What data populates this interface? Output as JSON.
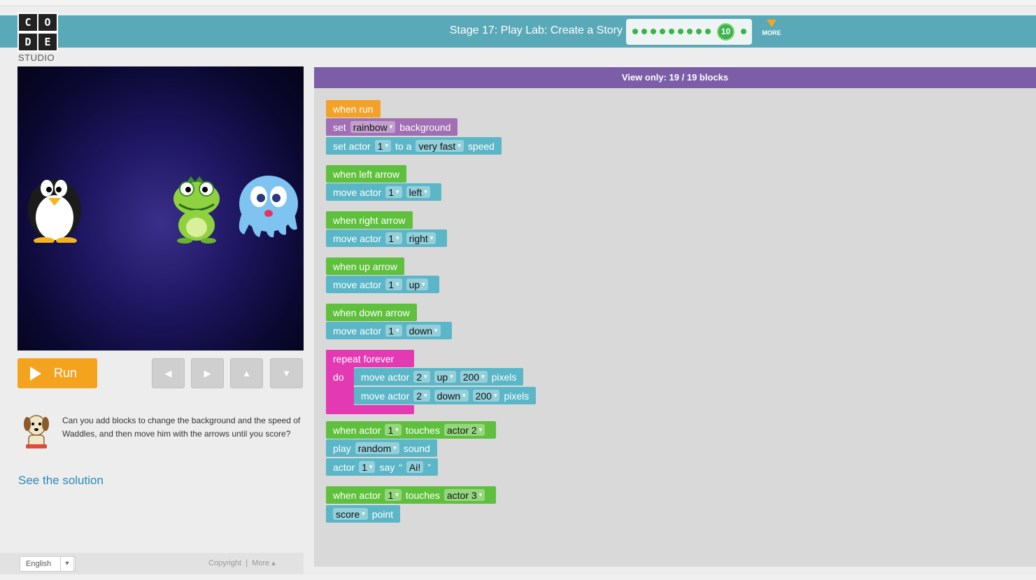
{
  "logo": {
    "letters": [
      "C",
      "O",
      "D",
      "E"
    ],
    "studio": "STUDIO"
  },
  "header": {
    "stage_title": "Stage 17: Play Lab: Create a Story",
    "current_level": "10",
    "more_label": "MORE"
  },
  "controls": {
    "run_label": "Run",
    "arrows": [
      "left-arrow",
      "right-arrow",
      "up-arrow",
      "down-arrow"
    ]
  },
  "instructions": {
    "text": "Can you add blocks to change the background and the speed of Waddles, and then move him with the arrows until you score?",
    "solution_link": "See the solution"
  },
  "footer": {
    "language": "English",
    "copyright": "Copyright",
    "more": "More ▴"
  },
  "workspace": {
    "header": "View only: 19 / 19 blocks",
    "blocks": {
      "when_run": "when run",
      "set_bg": [
        "set",
        "rainbow",
        "background"
      ],
      "set_speed": [
        "set actor",
        "1",
        "to a",
        "very fast",
        "speed"
      ],
      "when_left": "when left arrow",
      "move_left": [
        "move actor",
        "1",
        "left"
      ],
      "when_right": "when right arrow",
      "move_right": [
        "move actor",
        "1",
        "right"
      ],
      "when_up": "when up arrow",
      "move_up": [
        "move actor",
        "1",
        "up"
      ],
      "when_down": "when down arrow",
      "move_down": [
        "move actor",
        "1",
        "down"
      ],
      "repeat": "repeat forever",
      "do": "do",
      "move_up_px": [
        "move actor",
        "2",
        "up",
        "200",
        "pixels"
      ],
      "move_down_px": [
        "move actor",
        "2",
        "down",
        "200",
        "pixels"
      ],
      "touch1": [
        "when actor",
        "1",
        "touches",
        "actor 2"
      ],
      "play": [
        "play",
        "random",
        "sound"
      ],
      "say": [
        "actor",
        "1",
        "say",
        "“",
        "Ai!",
        "”"
      ],
      "touch2": [
        "when actor",
        "1",
        "touches",
        "actor 3"
      ],
      "score": [
        "score",
        "point"
      ]
    }
  },
  "colors": {
    "header": "#5aa9b8",
    "events": "#5fc03d",
    "actions": "#5bb6c7",
    "run": "#f2a12a",
    "loop": "#e33ab3",
    "workspace_header": "#7b5ea7"
  }
}
